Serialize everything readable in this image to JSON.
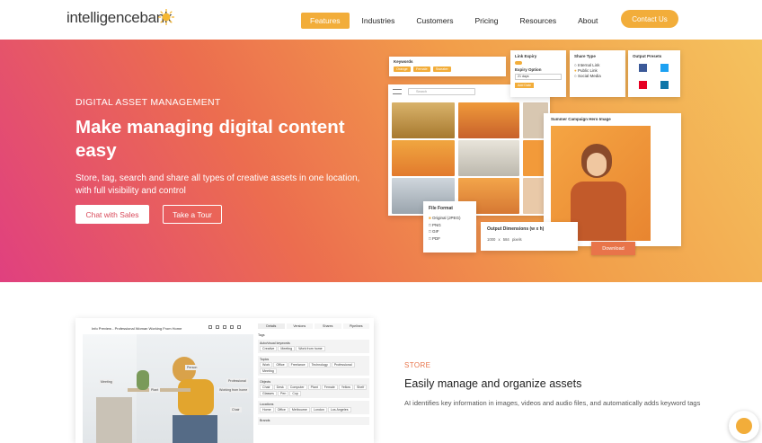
{
  "nav": {
    "logo": "intelligencebank",
    "items": [
      {
        "label": "Features",
        "active": true
      },
      {
        "label": "Industries"
      },
      {
        "label": "Customers"
      },
      {
        "label": "Pricing"
      },
      {
        "label": "Resources"
      },
      {
        "label": "About"
      }
    ],
    "contact": "Contact Us"
  },
  "hero": {
    "eyebrow": "DIGITAL ASSET MANAGEMENT",
    "title": "Make managing digital content easy",
    "subtitle": "Store, tag, search and share all types of creative assets in one location, with full visibility and control",
    "btn_primary": "Chat with Sales",
    "btn_secondary": "Take a Tour"
  },
  "mock": {
    "keywords_title": "Keywords",
    "keyword_chips": [
      "Orange",
      "Female",
      "Sweater"
    ],
    "link_expiry_title": "Link Expiry",
    "expiry_option": "Expiry Option",
    "expiry_value": "21 days",
    "expiry_btn": "Add Date",
    "share_title": "Share Type",
    "share_options": [
      "Internal Link",
      "Public Link",
      "Social Media"
    ],
    "presets_title": "Output Presets",
    "search_placeholder": "Search",
    "preview_title": "Summer Campaign Hero Image",
    "file_format_title": "File Format",
    "formats": [
      "Original (JPEG)",
      "PNG",
      "GIF",
      "PDF"
    ],
    "dims_title": "Output Dimensions (w x h)",
    "dims_w": "1000",
    "dims_x": "x",
    "dims_h": "584",
    "dims_unit": "pixels",
    "download": "Download"
  },
  "shot": {
    "title": "Info Preview - Professional Woman Working From Home",
    "tabs": [
      "Details",
      "Versions",
      "Shares",
      "Pipelines"
    ],
    "tags_label": "Tags",
    "groups": [
      {
        "name": "Auto/visual keywords",
        "tags": [
          "Creative",
          "Meeting",
          "Work from home"
        ]
      },
      {
        "name": "Topics",
        "tags": [
          "Work",
          "Office",
          "Freelance",
          "Technology",
          "Professional",
          "Meeting"
        ]
      },
      {
        "name": "Objects",
        "tags": [
          "Chair",
          "Desk",
          "Computer",
          "Plant",
          "Female",
          "Yellow",
          "Shelf",
          "Glasses",
          "Pen",
          "Cup"
        ]
      },
      {
        "name": "Locations",
        "tags": [
          "Home",
          "Office",
          "Melbourne",
          "London",
          "Los Angeles"
        ]
      },
      {
        "name": "Brands",
        "tags": []
      }
    ],
    "labels": [
      "Person",
      "Meeting",
      "Plant",
      "Professional",
      "Working from home",
      "Chair"
    ]
  },
  "store": {
    "eyebrow": "STORE",
    "title": "Easily manage and organize assets",
    "text": "AI identifies key information in images, videos and audio files, and automatically adds keyword tags"
  },
  "colors": {
    "accent": "#f2ad3a",
    "store_eyebrow": "#e8744a"
  }
}
